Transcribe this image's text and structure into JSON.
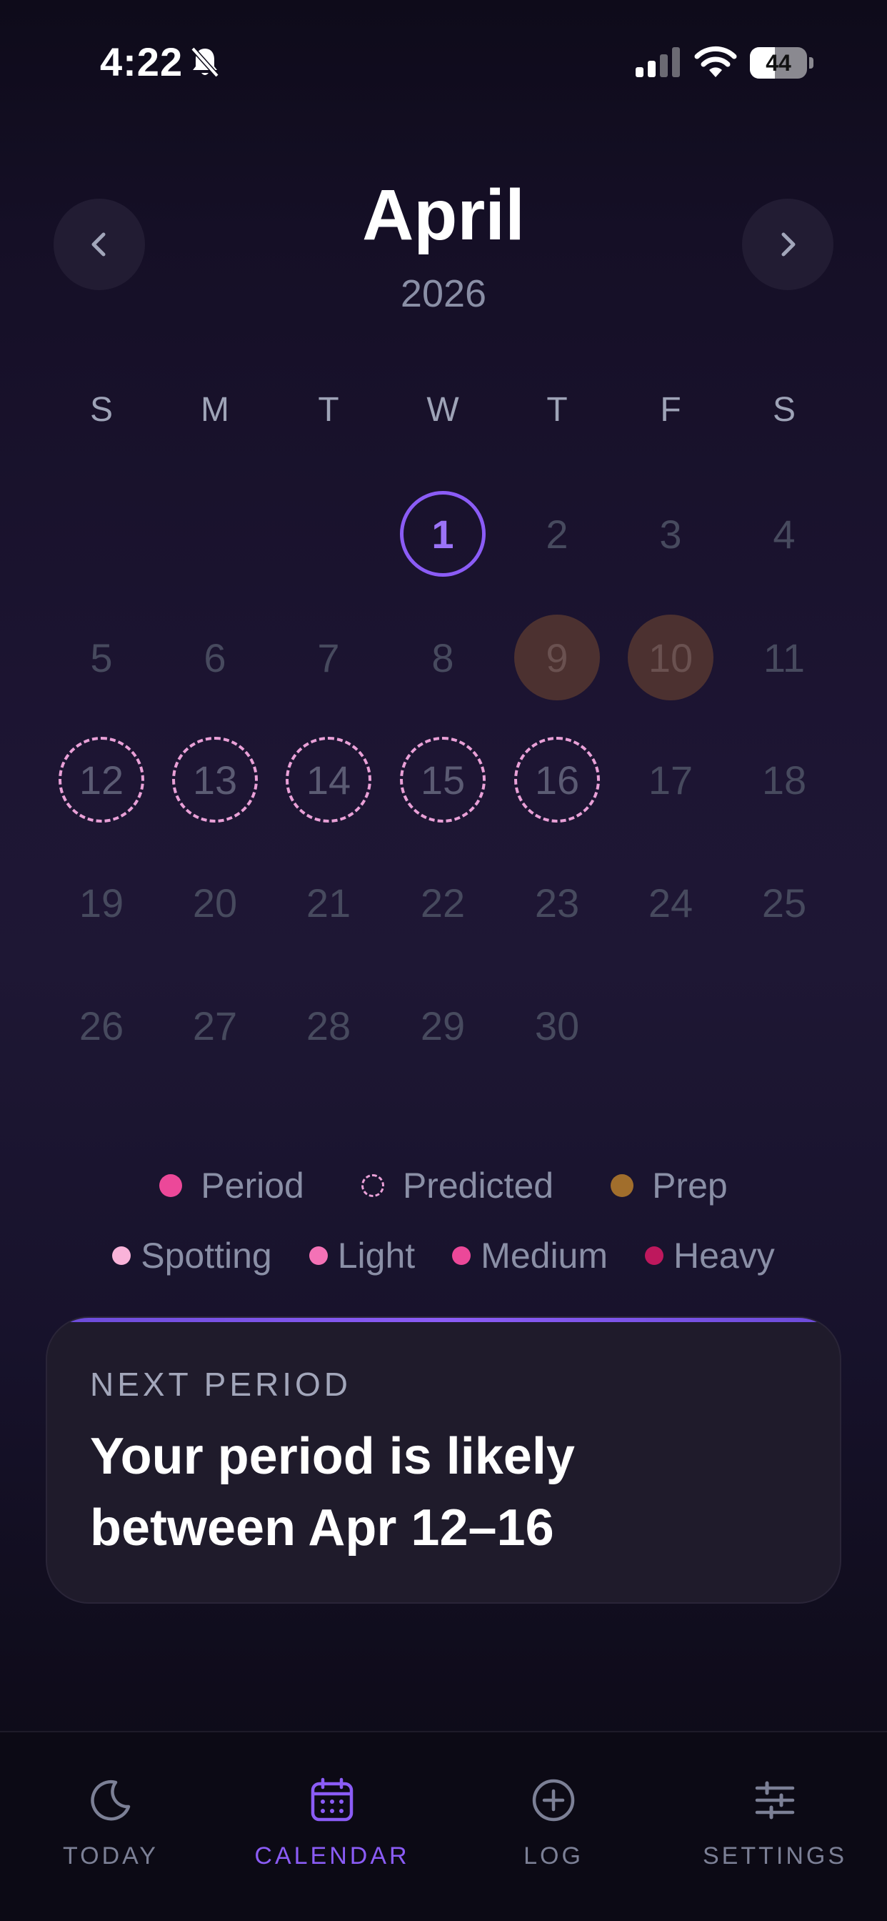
{
  "status_bar": {
    "time": "4:22",
    "battery": "44",
    "battery_level": 0.44
  },
  "header": {
    "month": "April",
    "year": "2026",
    "prev_icon": "chevron-left-icon",
    "next_icon": "chevron-right-icon"
  },
  "weekdays": [
    "S",
    "M",
    "T",
    "W",
    "T",
    "F",
    "S"
  ],
  "calendar": {
    "weeks": [
      [
        null,
        null,
        null,
        "1",
        "2",
        "3",
        "4"
      ],
      [
        "5",
        "6",
        "7",
        "8",
        "9",
        "10",
        "11"
      ],
      [
        "12",
        "13",
        "14",
        "15",
        "16",
        "17",
        "18"
      ],
      [
        "19",
        "20",
        "21",
        "22",
        "23",
        "24",
        "25"
      ],
      [
        "26",
        "27",
        "28",
        "29",
        "30",
        null,
        null
      ]
    ],
    "today": "1",
    "prep_days": [
      "9",
      "10"
    ],
    "predicted_days": [
      "12",
      "13",
      "14",
      "15",
      "16"
    ]
  },
  "legend": {
    "period": "Period",
    "predicted": "Predicted",
    "prep": "Prep",
    "spotting": "Spotting",
    "light": "Light",
    "medium": "Medium",
    "heavy": "Heavy"
  },
  "colors": {
    "accent": "#8b5cf6",
    "period": "#ec4899",
    "predicted": "#e9a0d7",
    "prep": "#a16e2c",
    "spotting": "#f9b3d9",
    "light": "#f472b6",
    "medium": "#ec4899",
    "heavy": "#be185d"
  },
  "next_period": {
    "label": "NEXT PERIOD",
    "line1": "Your period is likely",
    "line2": "between Apr 12–16"
  },
  "tabs": [
    {
      "label": "TODAY",
      "icon": "moon-icon",
      "active": false
    },
    {
      "label": "CALENDAR",
      "icon": "calendar-icon",
      "active": true
    },
    {
      "label": "LOG",
      "icon": "plus-circle-icon",
      "active": false
    },
    {
      "label": "SETTINGS",
      "icon": "sliders-icon",
      "active": false
    }
  ]
}
